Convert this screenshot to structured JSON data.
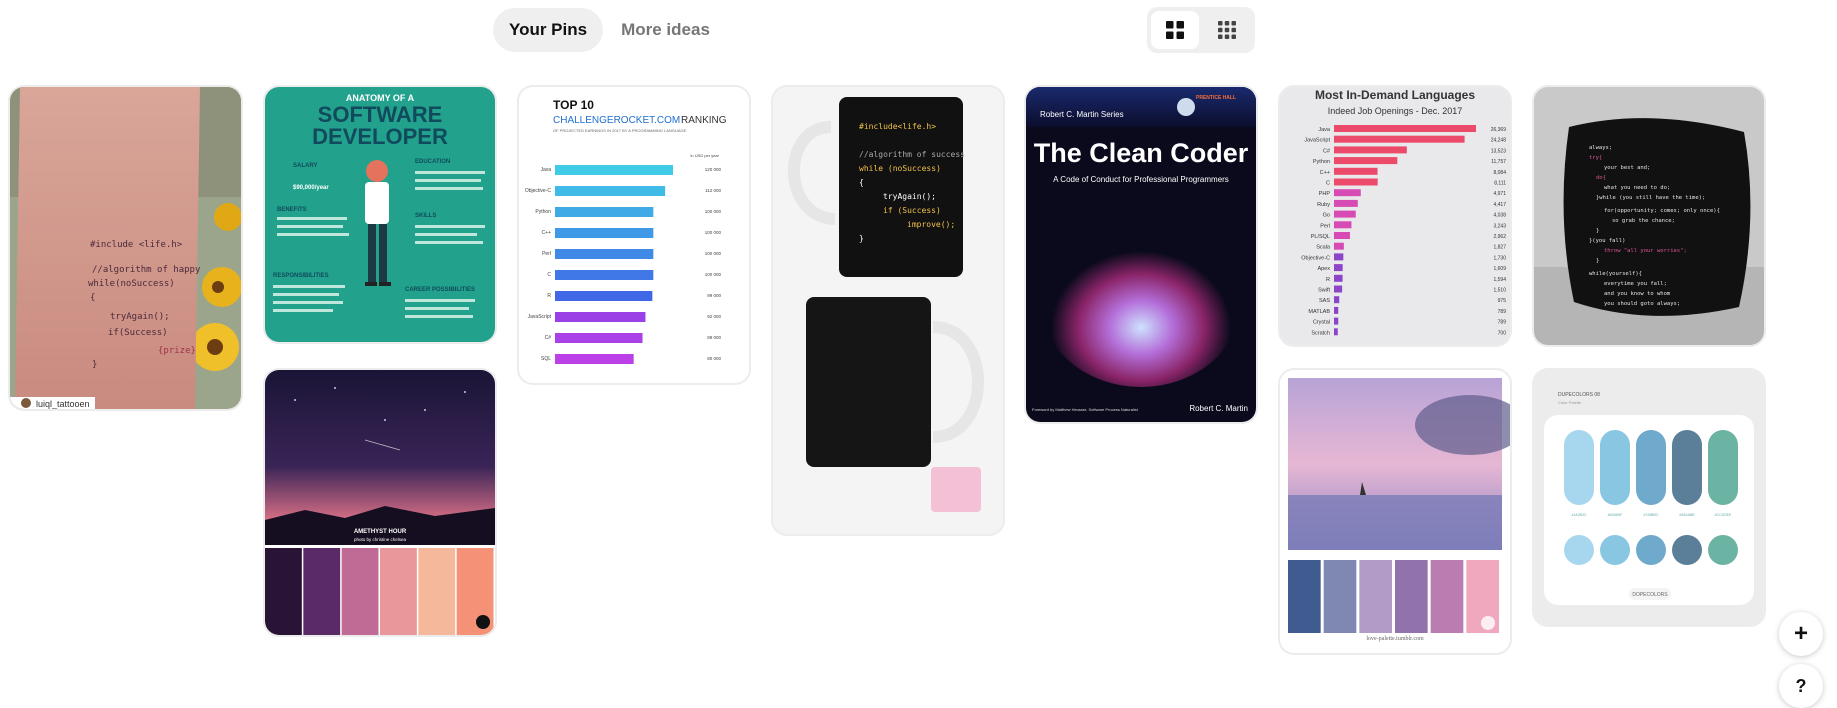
{
  "tabs": {
    "your_pins": "Your Pins",
    "more_ideas": "More ideas"
  },
  "pins": {
    "tattoo": {
      "code": [
        "#include <life.h>",
        "//algorithm of happy",
        "while(noSuccess)",
        "{",
        "tryAgain();",
        "if(Success)",
        "{prize}",
        "}"
      ],
      "attribution": "luiql_tattooen"
    },
    "anatomy": {
      "pre": "ANATOMY OF A",
      "title1": "SOFTWARE",
      "title2": "DEVELOPER",
      "salary_label": "SALARY",
      "salary_value": "$90,000/year",
      "education_label": "EDUCATION",
      "benefits_label": "BENEFITS",
      "skills_label": "SKILLS",
      "responsibilities_label": "RESPONSIBILITIES",
      "career_label": "CAREER POSSIBILITIES"
    },
    "top10": {
      "title": "TOP 10",
      "subtitle1": "CHALLENGEROCKET.COM",
      "subtitle2": "RANKING",
      "caption": "OF PROJECTED EARNINGS IN 2017 BY A PROGRAMMING LANGUAGE",
      "unit": "in USD per year",
      "langs": [
        "Java",
        "Objective-C",
        "Python",
        "C++",
        "Perl",
        "C",
        "R",
        "JavaScript",
        "C#",
        "SQL"
      ],
      "values": [
        120,
        112,
        100,
        100,
        100,
        100,
        99,
        92,
        89,
        80
      ],
      "value_labels": [
        "120 000",
        "112 000",
        "100 000",
        "100 000",
        "100 000",
        "100 000",
        "99 000",
        "92 000",
        "89 000",
        "80 000"
      ]
    },
    "mug": {
      "code": [
        "#include<life.h>",
        "",
        "//algorithm of success",
        "while (noSuccess)",
        "{",
        "tryAgain();",
        "if (Success)",
        "improve();",
        "}"
      ]
    },
    "clean_coder": {
      "publisher": "PRENTICE HALL",
      "series": "Robert C. Martin Series",
      "title": "The Clean Coder",
      "subtitle": "A Code of Conduct for Professional Programmers",
      "foreword": "Foreword by Matthew Heusser, Software Process Naturalist",
      "author": "Robert C. Martin"
    },
    "languages": {
      "title": "Most In-Demand Languages",
      "subtitle": "Indeed Job Openings - Dec. 2017",
      "langs": [
        "Java",
        "JavaScript",
        "C#",
        "Python",
        "C++",
        "C",
        "PHP",
        "Ruby",
        "Go",
        "Perl",
        "PL/SQL",
        "Scala",
        "Objective-C",
        "Apex",
        "R",
        "Swift",
        "SAS",
        "MATLAB",
        "Crystal",
        "Scratch"
      ],
      "values": [
        26369,
        24248,
        13523,
        11757,
        8084,
        8111,
        4971,
        4417,
        4038,
        3243,
        2962,
        1827,
        1730,
        1609,
        1594,
        1510,
        975,
        789,
        789,
        700
      ],
      "value_labels": [
        "26,369",
        "24,248",
        "13,523",
        "11,757",
        "8,084",
        "8,111",
        "4,971",
        "4,417",
        "4,038",
        "3,243",
        "2,962",
        "1,827",
        "1,730",
        "1,609",
        "1,594",
        "1,510",
        "975",
        "789",
        "789",
        "700"
      ]
    },
    "pillow": {
      "code": [
        "always;",
        "try{",
        "your best and;",
        "do{",
        "what you need to do;",
        "}while (you still have the time);",
        "for(opportunity; comes; only once){",
        "so grab the chance;",
        "}",
        "}(you fall)",
        "throw \"all your worries\";",
        "}",
        "while(yourself){",
        "everytime you fall;",
        "and you know to whom",
        "you should goto always;"
      ]
    },
    "amethyst": {
      "title": "AMETHYST HOUR",
      "credit": "photo by christine chelsea",
      "colors": [
        "#2a1436",
        "#5a2a66",
        "#c06a96",
        "#e8989a",
        "#f6b89a",
        "#f59176"
      ]
    },
    "seascape": {
      "colors": [
        "#3f5b8f",
        "#7f88b3",
        "#b29bc7",
        "#9272ad",
        "#ba7cb1",
        "#f0a8bf"
      ],
      "credit": "love-palette.tumblr.com"
    },
    "ui_palette": {
      "header": "DUPECOLORS 08",
      "sub": "Color Palette",
      "labels": [
        "#1A2B3C",
        "#4D5E6F",
        "#7A8B9C",
        "#99AABB",
        "#CCDDEE"
      ],
      "button": "DOPECOLORS",
      "colors": [
        "#a7d7ee",
        "#88c6e2",
        "#6fa9cc",
        "#5b7f99",
        "#6bb3a3"
      ]
    }
  },
  "fab": {
    "plus": "+",
    "help": "?"
  }
}
